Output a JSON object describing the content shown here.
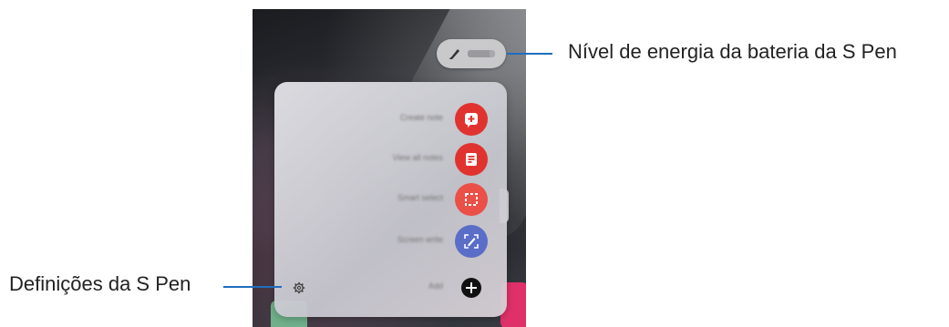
{
  "callouts": {
    "battery_label": "Nível de energia da bateria da S Pen",
    "settings_label": "Definições da S Pen"
  },
  "battery": {
    "level_percent": 80
  },
  "menu": {
    "items": [
      {
        "label": "Create note",
        "icon": "note-plus-icon",
        "color": "#e0332f"
      },
      {
        "label": "View all notes",
        "icon": "notes-list-icon",
        "color": "#e0332f"
      },
      {
        "label": "Smart select",
        "icon": "smart-select-icon",
        "color": "#ea4f48"
      },
      {
        "label": "Screen write",
        "icon": "screen-write-icon",
        "color": "#5a6ec8"
      },
      {
        "label": "Add",
        "icon": "add-icon",
        "color": "#111111"
      }
    ]
  },
  "colors": {
    "callout_line": "#1f6dbf"
  }
}
